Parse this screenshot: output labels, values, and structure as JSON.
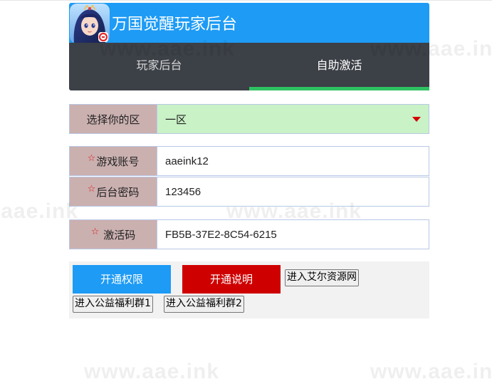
{
  "app": {
    "title": "万国觉醒玩家后台"
  },
  "tabs": [
    {
      "label": "玩家后台",
      "active": false
    },
    {
      "label": "自助激活",
      "active": true
    }
  ],
  "form": {
    "zone": {
      "label": "选择你的区",
      "value": "一区"
    },
    "account": {
      "required": true,
      "required_mark": "☆",
      "label": "游戏账号",
      "value": "aaeink12"
    },
    "password": {
      "required": true,
      "required_mark": "☆",
      "label": "后台密码",
      "value": "123456"
    },
    "activation_code": {
      "required": true,
      "required_mark": "☆",
      "label": " 激活码",
      "value": "FB5B-37E2-8C54-6215"
    }
  },
  "buttons": {
    "open_permission": "开通权限",
    "open_instructions": "开通说明",
    "enter_resource_site": "进入艾尔资源网",
    "enter_group_1": "进入公益福利群1",
    "enter_group_2": "进入公益福利群2"
  },
  "watermark_text": "www.aae.ink",
  "colors": {
    "header_blue": "#1d9bf5",
    "tabs_dark": "#3c4047",
    "active_tab_underline": "#2fc262",
    "label_bg": "#cbb0b0",
    "select_bg": "#c9f2c6",
    "required_star": "#e01515",
    "primary_button": "#1d9bf5",
    "danger_button": "#cf0000"
  }
}
